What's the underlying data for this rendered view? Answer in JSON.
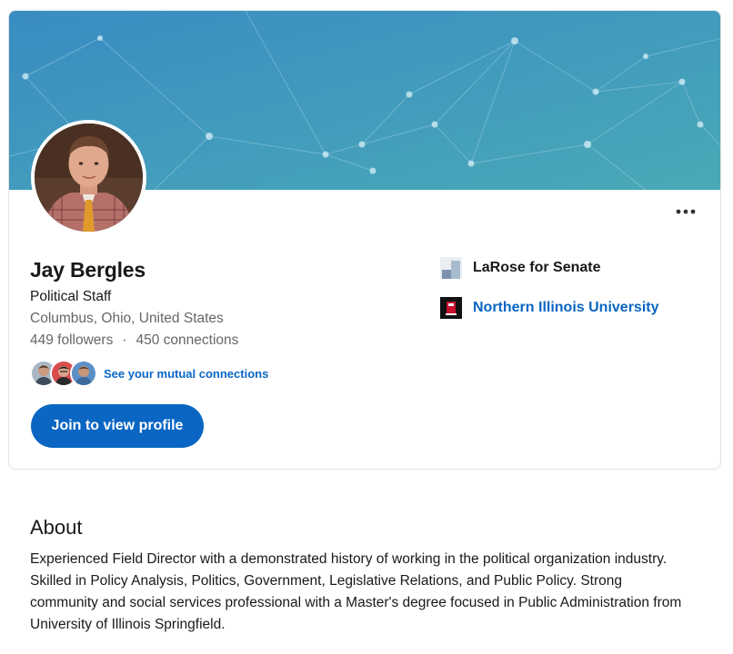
{
  "profile": {
    "name": "Jay Bergles",
    "headline": "Political Staff",
    "location": "Columbus, Ohio, United States",
    "followers": "449 followers",
    "separator": "·",
    "connections": "450 connections",
    "mutual_link": "See your mutual connections",
    "join_button": "Join to view profile",
    "more_icon": "more-horizontal-icon"
  },
  "experience": [
    {
      "label": "LaRose for Senate",
      "icon": "company-logo-icon"
    },
    {
      "label": "Northern Illinois University",
      "icon": "university-logo-icon"
    }
  ],
  "about": {
    "title": "About",
    "text": "Experienced Field Director with a demonstrated history of working in the political organization industry. Skilled in Policy Analysis, Politics, Government, Legislative Relations, and Public Policy. Strong community and social services professional with a Master's degree focused in Public Administration from University of Illinois Springfield."
  },
  "colors": {
    "accent": "#0a66c2",
    "cover_start": "#3b8fc4",
    "cover_end": "#47a8b8",
    "text_primary": "#191919",
    "text_secondary": "#666666"
  }
}
